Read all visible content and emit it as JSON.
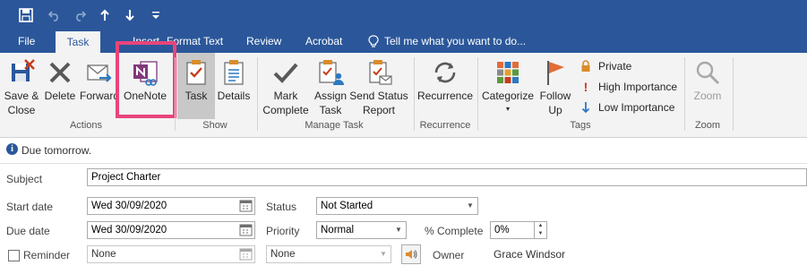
{
  "qat": {
    "save_icon": "save-icon",
    "undo_icon": "undo-icon",
    "redo_icon": "redo-icon",
    "up_icon": "arrow-up-icon",
    "down_icon": "arrow-down-icon",
    "customize_icon": "customize-icon"
  },
  "tabs": {
    "file": "File",
    "task": "Task",
    "insert": "Insert",
    "format_text": "Format Text",
    "review": "Review",
    "acrobat": "Acrobat",
    "tell_me": "Tell me what you want to do..."
  },
  "ribbon": {
    "save_close": "Save &\nClose",
    "delete": "Delete",
    "forward": "Forward",
    "onenote": "OneNote",
    "task": "Task",
    "details": "Details",
    "mark_complete": "Mark\nComplete",
    "assign_task": "Assign\nTask",
    "send_status": "Send Status\nReport",
    "recurrence": "Recurrence",
    "categorize": "Categorize",
    "follow_up": "Follow\nUp",
    "private": "Private",
    "high_importance": "High Importance",
    "low_importance": "Low Importance",
    "zoom": "Zoom",
    "groups": {
      "actions": "Actions",
      "show": "Show",
      "manage_task": "Manage Task",
      "recurrence": "Recurrence",
      "tags": "Tags",
      "zoom": "Zoom"
    },
    "highlight_color": "#e8457a"
  },
  "info": {
    "message": "Due tomorrow."
  },
  "form": {
    "subject_label": "Subject",
    "subject_value": "Project Charter",
    "start_label": "Start date",
    "start_value": "Wed 30/09/2020",
    "due_label": "Due date",
    "due_value": "Wed 30/09/2020",
    "status_label": "Status",
    "status_value": "Not Started",
    "priority_label": "Priority",
    "priority_value": "Normal",
    "complete_label": "% Complete",
    "complete_value": "0%",
    "reminder_label": "Reminder",
    "reminder_date": "None",
    "reminder_time": "None",
    "owner_label": "Owner",
    "owner_value": "Grace Windsor"
  },
  "colors": {
    "accent": "#2b579a",
    "ribbon_bg": "#f3f3f3"
  }
}
